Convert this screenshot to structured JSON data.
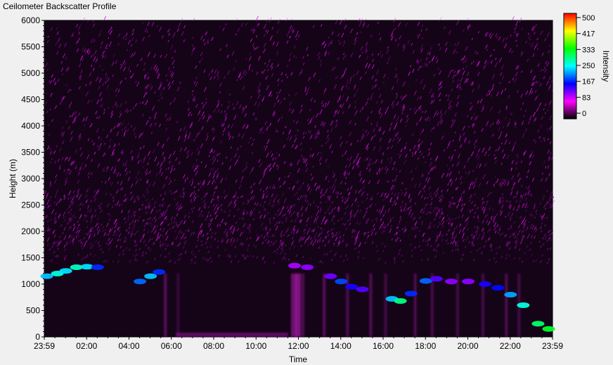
{
  "window": {
    "title": "Ceilometer Backscatter Profile"
  },
  "chart_data": {
    "type": "heatmap",
    "title": "",
    "xlabel": "Time",
    "ylabel": "Height (m)",
    "x_tick_labels": [
      "23:59",
      "02:00",
      "04:00",
      "06:00",
      "08:00",
      "10:00",
      "12:00",
      "14:00",
      "16:00",
      "18:00",
      "20:00",
      "22:00",
      "23:59"
    ],
    "y_tick_values": [
      0,
      500,
      1000,
      1500,
      2000,
      2500,
      3000,
      3500,
      4000,
      4500,
      5000,
      5500,
      6000
    ],
    "y_tick_labels": [
      "0",
      "500",
      "1000",
      "1500",
      "2000",
      "2500",
      "3000",
      "3500",
      "4000",
      "4500",
      "5000",
      "5500",
      "6000"
    ],
    "xlim_hours": [
      -0.017,
      23.983
    ],
    "ylim": [
      0,
      6000
    ],
    "colorbar": {
      "label": "Intensity",
      "tick_labels": [
        "500",
        "417",
        "333",
        "250",
        "167",
        "83",
        "0"
      ],
      "range": [
        0,
        500
      ],
      "stops": [
        "#000000",
        "#ff00ff",
        "#0000ff",
        "#00ffff",
        "#00ff00",
        "#ffff00",
        "#ff0000"
      ]
    },
    "background_color": "#1a0520",
    "cloud_layer": [
      {
        "t": 0.1,
        "h": 1150,
        "i": 230
      },
      {
        "t": 0.6,
        "h": 1200,
        "i": 260
      },
      {
        "t": 1.0,
        "h": 1250,
        "i": 240
      },
      {
        "t": 1.5,
        "h": 1320,
        "i": 270
      },
      {
        "t": 2.0,
        "h": 1330,
        "i": 240
      },
      {
        "t": 2.5,
        "h": 1320,
        "i": 180
      },
      {
        "t": 4.5,
        "h": 1050,
        "i": 200
      },
      {
        "t": 5.0,
        "h": 1150,
        "i": 230
      },
      {
        "t": 5.4,
        "h": 1230,
        "i": 180
      },
      {
        "t": 11.8,
        "h": 1350,
        "i": 110
      },
      {
        "t": 12.4,
        "h": 1320,
        "i": 120
      },
      {
        "t": 13.5,
        "h": 1150,
        "i": 130
      },
      {
        "t": 14.0,
        "h": 1050,
        "i": 190
      },
      {
        "t": 14.5,
        "h": 950,
        "i": 160
      },
      {
        "t": 15.0,
        "h": 900,
        "i": 140
      },
      {
        "t": 16.4,
        "h": 720,
        "i": 230
      },
      {
        "t": 16.8,
        "h": 680,
        "i": 290
      },
      {
        "t": 17.3,
        "h": 820,
        "i": 180
      },
      {
        "t": 18.0,
        "h": 1060,
        "i": 200
      },
      {
        "t": 18.5,
        "h": 1100,
        "i": 140
      },
      {
        "t": 19.2,
        "h": 1050,
        "i": 120
      },
      {
        "t": 20.0,
        "h": 1050,
        "i": 120
      },
      {
        "t": 20.8,
        "h": 1000,
        "i": 160
      },
      {
        "t": 21.4,
        "h": 930,
        "i": 170
      },
      {
        "t": 22.0,
        "h": 800,
        "i": 220
      },
      {
        "t": 22.6,
        "h": 600,
        "i": 260
      },
      {
        "t": 23.3,
        "h": 250,
        "i": 300
      },
      {
        "t": 23.8,
        "h": 150,
        "i": 320
      }
    ]
  }
}
